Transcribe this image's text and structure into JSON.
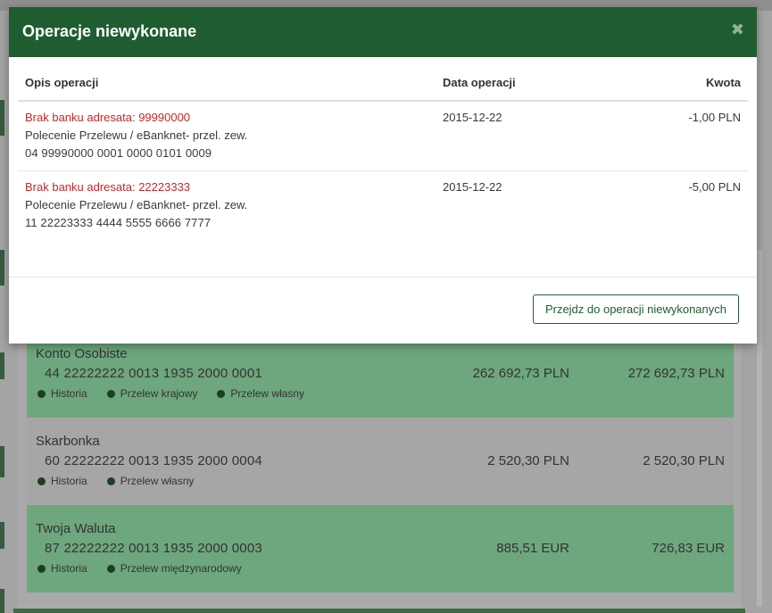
{
  "modal": {
    "title": "Operacje niewykonane",
    "close_icon": "close-icon",
    "columns": {
      "description": "Opis operacji",
      "date": "Data operacji",
      "amount": "Kwota"
    },
    "rows": [
      {
        "error": "Brak banku adresata: 99990000",
        "line1": "Polecenie Przelewu / eBanknet- przel. zew.",
        "line2": "04 99990000 0001 0000 0101 0009",
        "date": "2015-12-22",
        "amount": "-1,00 PLN"
      },
      {
        "error": "Brak banku adresata: 22223333",
        "line1": "Polecenie Przelewu / eBanknet- przel. zew.",
        "line2": "11 22223333 4444 5555 6666 7777",
        "date": "2015-12-22",
        "amount": "-5,00 PLN"
      }
    ],
    "goto_button": "Przejdz do operacji niewykonanych",
    "error_color": "#c62828",
    "header_color": "#1f5d31"
  },
  "accounts": [
    {
      "name": "Konto Osobiste",
      "number": "44 22222222 0013 1935 2000 0001",
      "balance": "262 692,73 PLN",
      "available": "272 692,73 PLN",
      "links": [
        "Historia",
        "Przelew krajowy",
        "Przelew własny"
      ]
    },
    {
      "name": "Skarbonka",
      "number": "60 22222222 0013 1935 2000 0004",
      "balance": "2 520,30 PLN",
      "available": "2 520,30 PLN",
      "links": [
        "Historia",
        "Przelew własny"
      ]
    },
    {
      "name": "Twoja Waluta",
      "number": "87 22222222 0013 1935 2000 0003",
      "balance": "885,51 EUR",
      "available": "726,83 EUR",
      "links": [
        "Historia",
        "Przelew międzynarodowy"
      ]
    }
  ]
}
